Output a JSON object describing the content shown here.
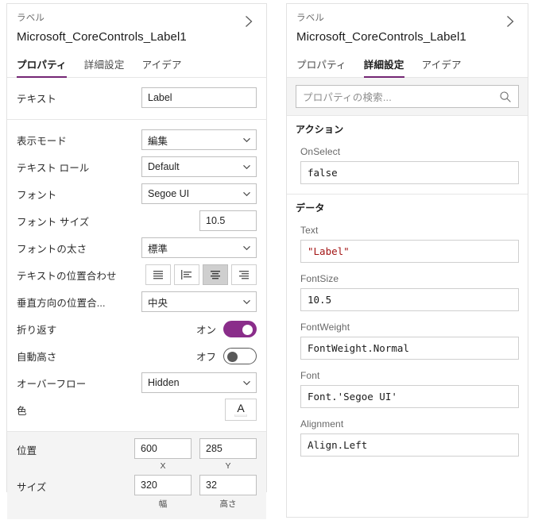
{
  "left_panel": {
    "header": {
      "type_label": "ラベル",
      "title": "Microsoft_CoreControls_Label1",
      "collapse_icon": "chevron-right-icon"
    },
    "tabs": [
      {
        "label": "プロパティ",
        "active": true
      },
      {
        "label": "詳細設定",
        "active": false
      },
      {
        "label": "アイデア",
        "active": false
      }
    ],
    "groups": [
      {
        "rows": [
          {
            "label": "テキスト",
            "control": "textfield",
            "value": "Label"
          }
        ]
      },
      {
        "rows": [
          {
            "label": "表示モード",
            "control": "select",
            "value": "編集"
          },
          {
            "label": "テキスト ロール",
            "control": "select",
            "value": "Default"
          },
          {
            "label": "フォント",
            "control": "select",
            "value": "Segoe UI"
          },
          {
            "label": "フォント サイズ",
            "control": "textfield-small",
            "value": "10.5"
          },
          {
            "label": "フォントの太さ",
            "control": "select",
            "value": "標準"
          },
          {
            "label": "テキストの位置合わせ",
            "control": "alignment",
            "selected_index": 2,
            "options": [
              "align-justify-icon",
              "align-left-icon",
              "align-center-icon",
              "align-right-icon"
            ]
          },
          {
            "label": "垂直方向の位置合...",
            "control": "select",
            "value": "中央"
          },
          {
            "label": "折り返す",
            "control": "toggle",
            "state_label": "オン",
            "on": true
          },
          {
            "label": "自動高さ",
            "control": "toggle",
            "state_label": "オフ",
            "on": false
          },
          {
            "label": "オーバーフロー",
            "control": "select",
            "value": "Hidden"
          },
          {
            "label": "色",
            "control": "color",
            "glyph": "A"
          }
        ]
      }
    ],
    "position_group": {
      "position": {
        "label": "位置",
        "x": "600",
        "y": "285",
        "x_caption": "X",
        "y_caption": "Y"
      },
      "size": {
        "label": "サイズ",
        "width": "320",
        "height": "32",
        "width_caption": "幅",
        "height_caption": "高さ"
      }
    }
  },
  "right_panel": {
    "header": {
      "type_label": "ラベル",
      "title": "Microsoft_CoreControls_Label1",
      "collapse_icon": "chevron-right-icon"
    },
    "tabs": [
      {
        "label": "プロパティ",
        "active": false
      },
      {
        "label": "詳細設定",
        "active": true
      },
      {
        "label": "アイデア",
        "active": false
      }
    ],
    "search": {
      "placeholder": "プロパティの検索...",
      "icon": "search-icon"
    },
    "sections": [
      {
        "title": "アクション",
        "properties": [
          {
            "name": "OnSelect",
            "value": "false"
          }
        ]
      },
      {
        "title": "データ",
        "properties": [
          {
            "name": "Text",
            "value": "\"Label\"",
            "is_string": true
          },
          {
            "name": "FontSize",
            "value": "10.5"
          },
          {
            "name": "FontWeight",
            "value": "FontWeight.Normal"
          },
          {
            "name": "Font",
            "value": "Font.'Segoe UI'"
          },
          {
            "name": "Alignment",
            "value": "Align.Left"
          }
        ]
      }
    ]
  },
  "colors": {
    "accent": "#742774",
    "toggle_on": "#8a2d8a",
    "panel_border": "#e2e2e2",
    "group_bg": "#f4f4f4",
    "string_literal": "#a31515"
  }
}
